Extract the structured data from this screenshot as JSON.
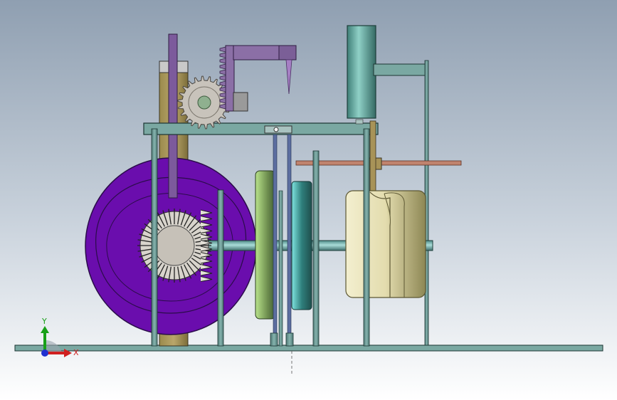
{
  "triad": {
    "x_label": "X",
    "y_label": "Y"
  },
  "colors": {
    "cam": "#6a0dad",
    "frame": "#6f9a96",
    "gear": "#c8c3bb",
    "rack": "#8b6fa6",
    "cylinder": "#6ab0a6",
    "drum": "#e7e2b9",
    "shaft": "#7fbfbd",
    "rod": "#c0836e"
  }
}
